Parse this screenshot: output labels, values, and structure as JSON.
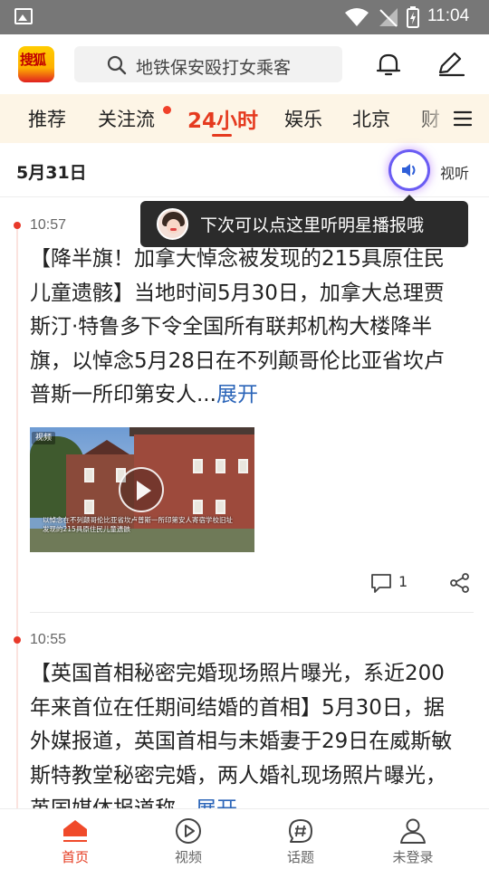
{
  "status_bar": {
    "time": "11:04"
  },
  "header": {
    "logo_text": "搜狐",
    "search_placeholder": "地铁保安殴打女乘客"
  },
  "channels": {
    "tabs": [
      {
        "label": "推荐"
      },
      {
        "label": "关注流",
        "has_dot": true
      },
      {
        "label": "24小时",
        "active": true
      },
      {
        "label": "娱乐"
      },
      {
        "label": "北京"
      },
      {
        "label": "财"
      }
    ]
  },
  "date_bar": {
    "date": "5月31日",
    "listen_label": "视听"
  },
  "tooltip": {
    "text": "下次可以点这里听明星播报哦"
  },
  "feed": {
    "items": [
      {
        "time": "10:57",
        "text": "【降半旗！加拿大悼念被发现的215具原住民儿童遗骸】当地时间5月30日，加拿大总理贾斯汀·特鲁多下令全国所有联邦机构大楼降半旗，以悼念5月28日在不列颠哥伦比亚省坎卢普斯一所印第安人...",
        "expand_label": "展开",
        "video_badge": "视频",
        "video_caption": "以悼念在不列颠哥伦比亚省坎卢普斯一所印第安人寄宿学校旧址发现的215具原住民儿童遗骸",
        "comment_count": "1"
      },
      {
        "time": "10:55",
        "text": "【英国首相秘密完婚现场照片曝光，系近200年来首位在任期间结婚的首相】5月30日，据外媒报道，英国首相与未婚妻于29日在威斯敏斯特教堂秘密完婚，两人婚礼现场照片曝光，英国媒体报道称...",
        "expand_label": "展开"
      }
    ]
  },
  "bottom_nav": {
    "items": [
      {
        "label": "首页",
        "icon": "home-icon",
        "active": true
      },
      {
        "label": "视频",
        "icon": "video-play-icon"
      },
      {
        "label": "话题",
        "icon": "hashtag-icon"
      },
      {
        "label": "未登录",
        "icon": "user-icon"
      }
    ]
  },
  "colors": {
    "accent": "#e53a1f",
    "tab_bar_bg": "#fdf5e6",
    "link_blue": "#2a64b8",
    "status_bar_bg": "#777777"
  }
}
